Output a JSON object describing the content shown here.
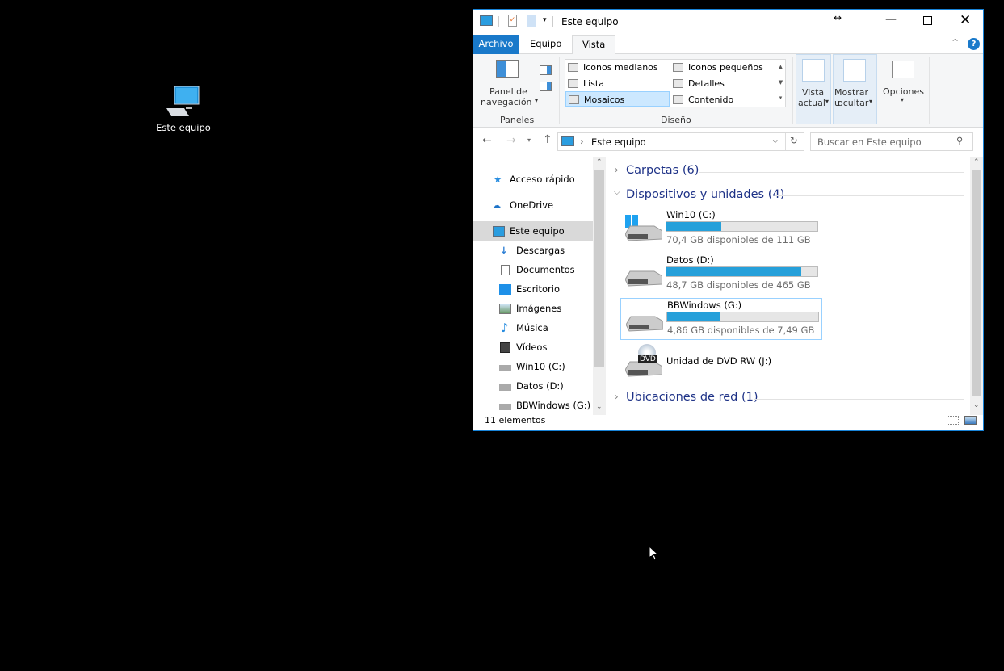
{
  "desktop": {
    "icon_label": "Este equipo"
  },
  "window": {
    "title": "Este equipo",
    "tabs": [
      {
        "label": "Archivo"
      },
      {
        "label": "Equipo"
      },
      {
        "label": "Vista"
      }
    ],
    "ribbon": {
      "panel_nav": "Panel de navegación",
      "panel_nav_l1": "Panel de",
      "panel_nav_l2": "navegación",
      "group_panes": "Paneles",
      "layouts": [
        "Iconos medianos",
        "Iconos pequeños",
        "Lista",
        "Detalles",
        "Mosaicos",
        "Contenido"
      ],
      "selected_layout": "Mosaicos",
      "group_layout": "Diseño",
      "current_view_l1": "Vista",
      "current_view_l2": "actual",
      "show_hide_l1": "Mostrar u",
      "show_hide_l2": "ocultar",
      "options": "Opciones"
    },
    "address": {
      "path": "Este equipo",
      "search_placeholder": "Buscar en Este equipo"
    },
    "nav": [
      {
        "label": "Acceso rápido"
      },
      {
        "label": "OneDrive"
      },
      {
        "label": "Este equipo"
      },
      {
        "label": "Descargas"
      },
      {
        "label": "Documentos"
      },
      {
        "label": "Escritorio"
      },
      {
        "label": "Imágenes"
      },
      {
        "label": "Música"
      },
      {
        "label": "Vídeos"
      },
      {
        "label": "Win10 (C:)"
      },
      {
        "label": "Datos (D:)"
      },
      {
        "label": "BBWindows (G:)"
      }
    ],
    "groups": {
      "folders": "Carpetas (6)",
      "devices": "Dispositivos y unidades (4)",
      "network": "Ubicaciones de red (1)"
    },
    "drives": [
      {
        "name": "Win10 (C:)",
        "space": "70,4 GB disponibles de 111 GB",
        "used_percent": 36.6
      },
      {
        "name": "Datos (D:)",
        "space": "48,7 GB disponibles de 465 GB",
        "used_percent": 89.5
      },
      {
        "name": "BBWindows (G:)",
        "space": "4,86 GB disponibles de 7,49 GB",
        "used_percent": 35.1
      },
      {
        "name": "Unidad de DVD RW (J:)",
        "dvd_label": "DVD"
      }
    ],
    "status": "11 elementos",
    "accent": "#1979ca"
  }
}
